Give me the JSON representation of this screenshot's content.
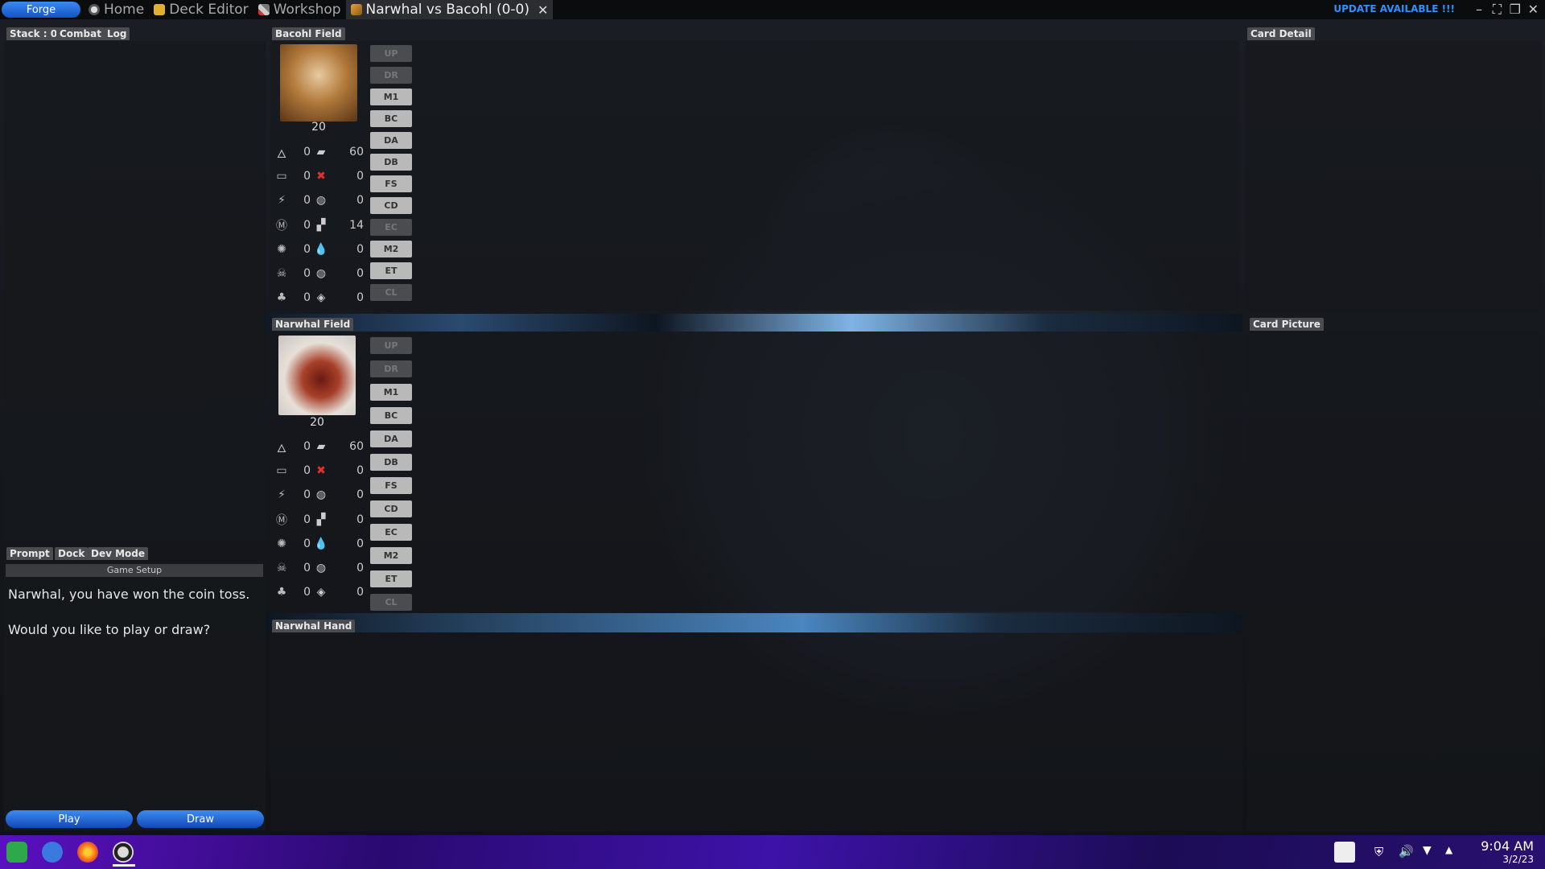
{
  "topbar": {
    "forge_label": "Forge",
    "tabs": [
      {
        "label": "Home"
      },
      {
        "label": "Deck Editor"
      },
      {
        "label": "Workshop"
      },
      {
        "label": "Narwhal vs Bacohl (0-0)",
        "active": true
      }
    ],
    "update_label": "UPDATE AVAILABLE !!!"
  },
  "left_tabs": {
    "stack": "Stack : 0",
    "combat": "Combat",
    "log": "Log"
  },
  "prompt_tabs": {
    "prompt": "Prompt",
    "dock": "Dock",
    "dev_mode": "Dev Mode"
  },
  "prompt": {
    "header": "Game Setup",
    "message": "Narwhal, you have won the coin toss.\n\nWould you like to play or draw?",
    "play_label": "Play",
    "draw_label": "Draw"
  },
  "right_panels": {
    "card_detail": "Card Detail",
    "card_picture": "Card Picture"
  },
  "hand_label": "Narwhal Hand",
  "phases": [
    "UP",
    "DR",
    "M1",
    "BC",
    "DA",
    "DB",
    "FS",
    "CD",
    "EC",
    "M2",
    "ET",
    "CL"
  ],
  "opponent": {
    "field_label": "Bacohl Field",
    "life": "20",
    "stats": [
      {
        "a": "0",
        "b": "60"
      },
      {
        "a": "0",
        "b": "0"
      },
      {
        "a": "0",
        "b": "0"
      },
      {
        "a": "0",
        "b": "14"
      },
      {
        "a": "0",
        "b": "0"
      },
      {
        "a": "0",
        "b": "0"
      },
      {
        "a": "0",
        "b": "0"
      }
    ],
    "phase_enabled": [
      false,
      false,
      true,
      true,
      true,
      true,
      true,
      true,
      false,
      true,
      true,
      false
    ]
  },
  "player": {
    "field_label": "Narwhal Field",
    "life": "20",
    "stats": [
      {
        "a": "0",
        "b": "60"
      },
      {
        "a": "0",
        "b": "0"
      },
      {
        "a": "0",
        "b": "0"
      },
      {
        "a": "0",
        "b": "0"
      },
      {
        "a": "0",
        "b": "0"
      },
      {
        "a": "0",
        "b": "0"
      },
      {
        "a": "0",
        "b": "0"
      }
    ],
    "phase_enabled": [
      false,
      false,
      true,
      true,
      true,
      true,
      true,
      true,
      true,
      true,
      true,
      false
    ]
  },
  "taskbar": {
    "time": "9:04 AM",
    "date": "3/2/23"
  }
}
